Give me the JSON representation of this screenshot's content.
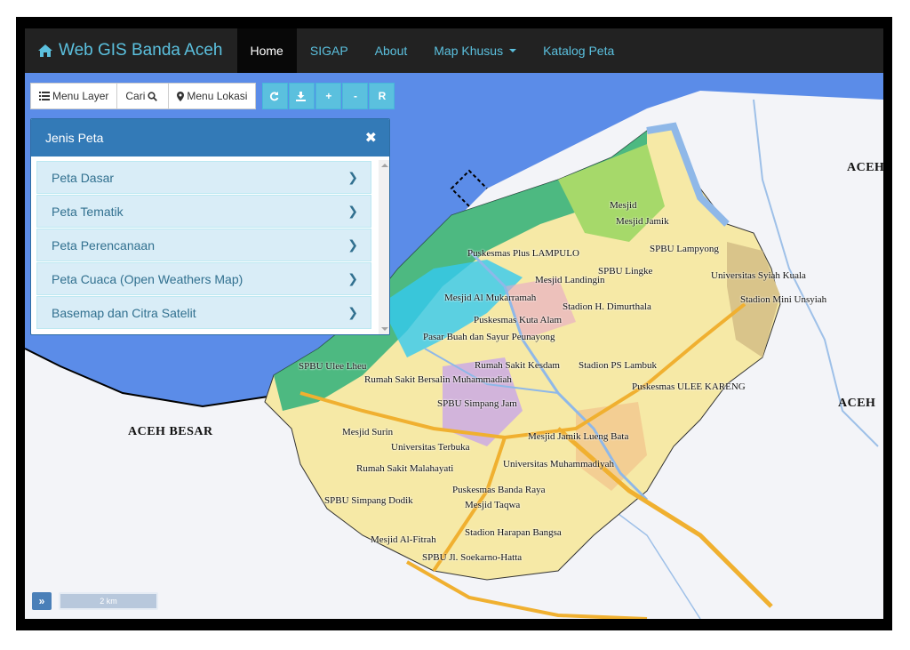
{
  "navbar": {
    "brand": "Web GIS Banda Aceh",
    "brand_icon": "home-icon",
    "items": [
      {
        "label": "Home",
        "active": true
      },
      {
        "label": "SIGAP"
      },
      {
        "label": "About"
      },
      {
        "label": "Map Khusus",
        "dropdown": true
      },
      {
        "label": "Katalog Peta"
      }
    ]
  },
  "toolbar": {
    "menu_layer": "Menu Layer",
    "cari": "Cari",
    "menu_lokasi": "Menu Lokasi",
    "plus": "+",
    "minus": "-",
    "reset": "R"
  },
  "panel": {
    "title": "Jenis Peta",
    "close": "✖",
    "items": [
      "Peta Dasar",
      "Peta Tematik",
      "Peta Perencanaan",
      "Peta Cuaca (Open Weathers Map)",
      "Basemap dan Citra Satelit"
    ]
  },
  "map": {
    "regions": [
      "ACEH BESAR",
      "ACEH",
      "ACEH"
    ],
    "pois": [
      "Mesjid",
      "Mesjid Jamik",
      "Puskesmas Plus LAMPULO",
      "SPBU Lampyong",
      "SPBU Lingke",
      "Universitas Syiah Kuala",
      "Mesjid Landingin",
      "Stadion Mini Unsyiah",
      "Mesjid Al Mukarramah",
      "Stadion H. Dimurthala",
      "Puskesmas Kuta Alam",
      "Pasar Buah dan Sayur Peunayong",
      "SPBU Ulee Lheu",
      "Rumah Sakit Kesdam",
      "Stadion PS Lambuk",
      "Rumah Sakit Bersalin Muhammadiah",
      "Puskesmas ULEE KARENG",
      "SPBU Simpang Jam",
      "Mesjid Surin",
      "Mesjid Jamik Lueng Bata",
      "Universitas Terbuka",
      "Universitas Muhammadiyah",
      "Rumah Sakit Malahayati",
      "Puskesmas Banda Raya",
      "SPBU Simpang Dodik",
      "Mesjid Taqwa",
      "Stadion Harapan Bangsa",
      "Mesjid Al-Fitrah",
      "SPBU Jl. Soekarno-Hatta"
    ]
  },
  "scale": "2 km",
  "expand": "»",
  "colors": {
    "navbar": "#222222",
    "accent": "#5bc0de",
    "panel_header": "#337ab7",
    "panel_item": "#d9edf7",
    "sea": "#5b8ce8",
    "land": "#f6e9a6"
  }
}
